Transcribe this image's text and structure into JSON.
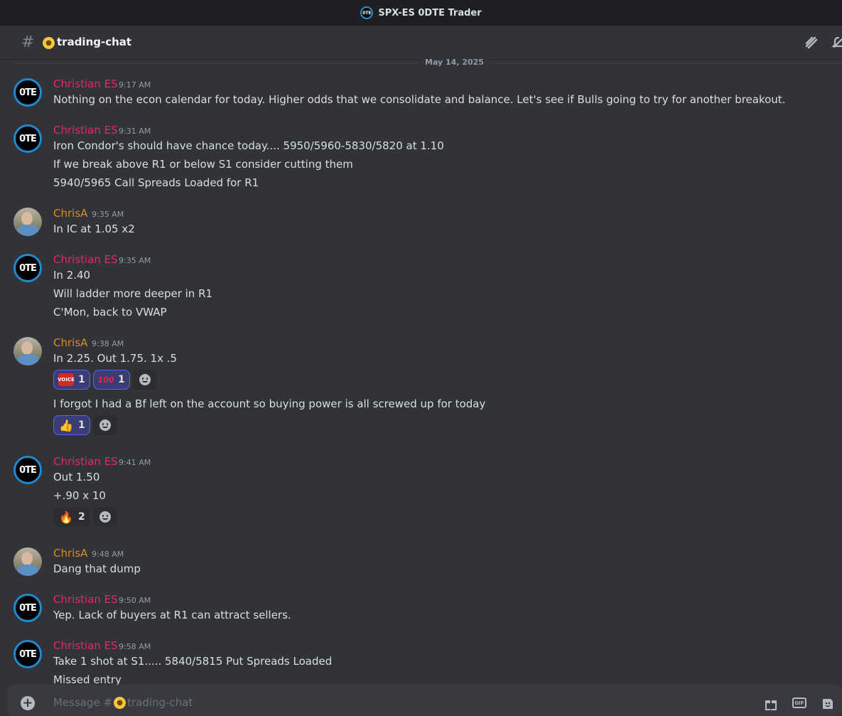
{
  "window": {
    "title": "SPX-ES 0DTE Trader",
    "server_icon_text": "0TE"
  },
  "channel": {
    "hash": "#",
    "emoji": "😐",
    "name": "trading-chat"
  },
  "date_divider": "May 14, 2025",
  "avatar_text": "0TE",
  "messages": [
    {
      "author": "Christian ES",
      "time": "9:17 AM",
      "lines": [
        "Nothing on the econ calendar for today. Higher odds that we consolidate and balance. Let's see if Bulls going to try for another breakout."
      ]
    },
    {
      "author": "Christian ES",
      "time": "9:31 AM",
      "lines": [
        "Iron Condor's should have chance today....  5950/5960-5830/5820 at 1.10",
        "If we break above R1 or below S1 consider cutting them",
        "5940/5965 Call Spreads Loaded for R1"
      ]
    },
    {
      "author": "ChrisA",
      "time": "9:35 AM",
      "lines": [
        "In IC at 1.05 x2"
      ]
    },
    {
      "author": "Christian ES",
      "time": "9:35 AM",
      "lines": [
        "In 2.40",
        "Will ladder more deeper in R1",
        "C'Mon, back to VWAP"
      ]
    },
    {
      "author": "ChrisA",
      "time": "9:38 AM",
      "lines": [
        "In 2.25. Out 1.75. 1x .5",
        "I forgot I had a Bf left on the account so buying power is all screwed up for today"
      ],
      "reactions_a": [
        {
          "emoji": "VOICE",
          "count": "1"
        },
        {
          "emoji": "💯",
          "count": "1"
        }
      ],
      "reactions_b": [
        {
          "emoji": "👍",
          "count": "1"
        }
      ]
    },
    {
      "author": "Christian ES",
      "time": "9:41 AM",
      "lines": [
        "Out 1.50",
        "+.90 x 10"
      ],
      "reactions": [
        {
          "emoji": "🔥",
          "count": "2"
        }
      ]
    },
    {
      "author": "ChrisA",
      "time": "9:48 AM",
      "lines": [
        "Dang that dump"
      ]
    },
    {
      "author": "Christian ES",
      "time": "9:50 AM",
      "lines": [
        "Yep. Lack of buyers at R1 can attract sellers."
      ]
    },
    {
      "author": "Christian ES",
      "time": "9:58 AM",
      "lines": [
        "Take 1 shot at S1.....   5840/5815 Put Spreads Loaded",
        "Missed entry"
      ]
    }
  ],
  "composer": {
    "placeholder_prefix": "Message #",
    "placeholder_channel": "trading-chat"
  },
  "colors": {
    "christian": "#e0286c",
    "chrisa": "#d98c24",
    "accent": "#5865f2"
  }
}
